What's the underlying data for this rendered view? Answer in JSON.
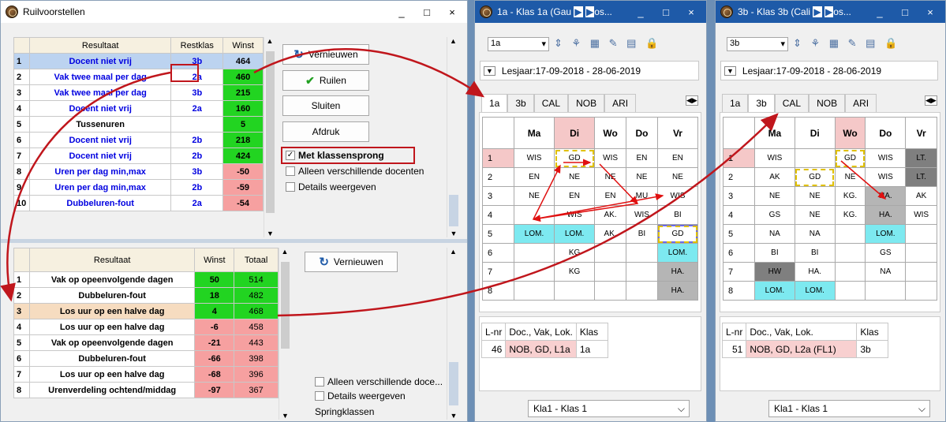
{
  "left": {
    "title": "Ruilvoorstellen",
    "window_buttons": [
      "_",
      "□",
      "×"
    ],
    "top_table": {
      "headers": [
        "Resultaat",
        "Restklas",
        "Winst"
      ],
      "rows": [
        {
          "n": "1",
          "result": "Docent niet vrij",
          "klas": "3b",
          "winst": "464",
          "color": "g",
          "blue": true
        },
        {
          "n": "2",
          "result": "Vak twee maal per dag",
          "klas": "2a",
          "winst": "460",
          "color": "g",
          "blue": true
        },
        {
          "n": "3",
          "result": "Vak twee maal per dag",
          "klas": "3b",
          "winst": "215",
          "color": "g",
          "blue": true
        },
        {
          "n": "4",
          "result": "Docent niet vrij",
          "klas": "2a",
          "winst": "160",
          "color": "g",
          "blue": true
        },
        {
          "n": "5",
          "result": "Tussenuren",
          "klas": "",
          "winst": "5",
          "color": "g",
          "blue": false
        },
        {
          "n": "6",
          "result": "Docent niet vrij",
          "klas": "2b",
          "winst": "218",
          "color": "g",
          "blue": true
        },
        {
          "n": "7",
          "result": "Docent niet vrij",
          "klas": "2b",
          "winst": "424",
          "color": "g",
          "blue": true
        },
        {
          "n": "8",
          "result": "Uren per dag min,max",
          "klas": "3b",
          "winst": "-50",
          "color": "r",
          "blue": true
        },
        {
          "n": "9",
          "result": "Uren per dag min,max",
          "klas": "2b",
          "winst": "-59",
          "color": "r",
          "blue": true
        },
        {
          "n": "10",
          "result": "Dubbeluren-fout",
          "klas": "2a",
          "winst": "-54",
          "color": "r",
          "blue": true
        }
      ],
      "buttons": {
        "refresh": "Vernieuwen",
        "swap": "Ruilen",
        "close": "Sluiten",
        "print": "Afdruk"
      },
      "checks": {
        "jump": "Met klassensprong",
        "diff": "Alleen verschillende docenten",
        "details": "Details weergeven"
      }
    },
    "bottom_table": {
      "headers": [
        "Resultaat",
        "Winst",
        "Totaal"
      ],
      "rows": [
        {
          "n": "1",
          "result": "Vak op opeenvolgende dagen",
          "winst": "50",
          "totaal": "514",
          "color": "g"
        },
        {
          "n": "2",
          "result": "Dubbeluren-fout",
          "winst": "18",
          "totaal": "482",
          "color": "g"
        },
        {
          "n": "3",
          "result": "Los uur op een halve dag",
          "winst": "4",
          "totaal": "468",
          "color": "g"
        },
        {
          "n": "4",
          "result": "Los uur op een halve dag",
          "winst": "-6",
          "totaal": "458",
          "color": "r"
        },
        {
          "n": "5",
          "result": "Vak op opeenvolgende dagen",
          "winst": "-21",
          "totaal": "443",
          "color": "r"
        },
        {
          "n": "6",
          "result": "Dubbeluren-fout",
          "winst": "-66",
          "totaal": "398",
          "color": "r"
        },
        {
          "n": "7",
          "result": "Los uur op een halve dag",
          "winst": "-68",
          "totaal": "396",
          "color": "r"
        },
        {
          "n": "8",
          "result": "Urenverdeling ochtend/middag",
          "winst": "-97",
          "totaal": "367",
          "color": "r"
        }
      ],
      "refresh": "Vernieuwen",
      "checks": {
        "diff": "Alleen verschillende doce...",
        "details": "Details weergeven"
      },
      "jump_label": "Springklassen"
    }
  },
  "tt1": {
    "title": "1a - Klas 1a (Gau",
    "title_tail": "os...",
    "class_select": "1a",
    "period": "Lesjaar:17-09-2018 - 28-06-2019",
    "tabs": [
      "1a",
      "3b",
      "CAL",
      "NOB",
      "ARI"
    ],
    "active_tab": 0,
    "days": [
      "Ma",
      "Di",
      "Wo",
      "Do",
      "Vr"
    ],
    "rows": [
      [
        "WIS",
        "GD",
        "WIS",
        "EN",
        "EN"
      ],
      [
        "EN",
        "NE",
        "NE",
        "NE",
        "NE"
      ],
      [
        "NE",
        "EN",
        "EN",
        "MU",
        "WIS"
      ],
      [
        "",
        "WIS",
        "AK.",
        "WIS",
        "BI"
      ],
      [
        "LOM.",
        "LOM.",
        "AK.",
        "BI",
        "GD"
      ],
      [
        "",
        "KG",
        "",
        "",
        "LOM."
      ],
      [
        "",
        "KG",
        "",
        "",
        "HA."
      ],
      [
        "",
        "",
        "",
        "",
        "HA."
      ]
    ],
    "lesson_headers": [
      "L-nr",
      "Doc., Vak, Lok.",
      "Klas"
    ],
    "lesson": {
      "nr": "46",
      "desc": "NOB, GD, L1a",
      "klas": "1a"
    },
    "footer": "Kla1 - Klas 1"
  },
  "tt2": {
    "title": "3b - Klas 3b (Cali",
    "title_tail": "os...",
    "class_select": "3b",
    "period": "Lesjaar:17-09-2018 - 28-06-2019",
    "tabs": [
      "1a",
      "3b",
      "CAL",
      "NOB",
      "ARI"
    ],
    "active_tab": 1,
    "days": [
      "Ma",
      "Di",
      "Wo",
      "Do",
      "Vr"
    ],
    "rows": [
      [
        "WIS",
        "",
        "GD",
        "WIS",
        "LT."
      ],
      [
        "AK",
        "GD",
        "NE",
        "WIS",
        "LT."
      ],
      [
        "NE",
        "NE",
        "KG.",
        "HA.",
        "AK"
      ],
      [
        "GS",
        "NE",
        "KG.",
        "HA.",
        "WIS"
      ],
      [
        "NA",
        "NA",
        "",
        "LOM.",
        ""
      ],
      [
        "BI",
        "BI",
        "",
        "GS",
        ""
      ],
      [
        "HW",
        "HA.",
        "",
        "NA",
        ""
      ],
      [
        "LOM.",
        "LOM.",
        "",
        "",
        ""
      ]
    ],
    "lesson_headers": [
      "L-nr",
      "Doc., Vak, Lok.",
      "Klas"
    ],
    "lesson": {
      "nr": "51",
      "desc": "NOB, GD, L2a (FL1)",
      "klas": "3b"
    },
    "footer": "Kla1 - Klas 1"
  },
  "icons": [
    "refresh-icon",
    "check-icon",
    "checkbox-icon",
    "scroll-up-icon",
    "scroll-down-icon",
    "dropdown-arrow-icon",
    "untis-logo-icon",
    "minimize-icon",
    "maximize-icon",
    "close-icon"
  ]
}
